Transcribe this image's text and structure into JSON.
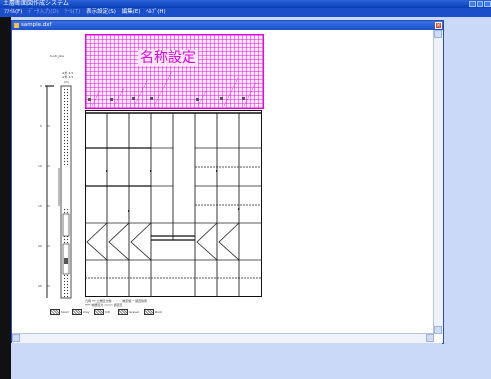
{
  "window": {
    "title": "土層断面図作成システム",
    "controls": [
      "minimize-icon",
      "maximize-icon",
      "close-icon"
    ]
  },
  "menubar": {
    "items": [
      {
        "label": "ﾌｧｲﾙ(F)",
        "enabled": true
      },
      {
        "label": "ﾃﾞｰﾀ入力(D)",
        "enabled": false
      },
      {
        "label": "ﾂｰﾙ(T)",
        "enabled": false
      },
      {
        "label": "表示設定(S)",
        "enabled": true
      },
      {
        "label": "編集(E)",
        "enabled": true
      },
      {
        "label": "ﾍﾙﾌﾟ(H)",
        "enabled": true
      }
    ]
  },
  "document": {
    "title": "sample.dxf",
    "close_glyph": "×",
    "header_title": "名称設定",
    "side_labels": [
      "tuuti_pile",
      "※外 4.5",
      "※外 4.5",
      "(m)"
    ],
    "depth_ticks": [
      "0",
      "5",
      "10",
      "15",
      "20",
      "25"
    ],
    "note_line1": "凡例  ━━ 土層区分線  ・・・ 推定線  ─ 調査箇所",
    "note_line2": "━━━ 地層区分  ▭▭▭ 調査孔",
    "legend": [
      "Sand",
      "Clay",
      "Silt",
      "Gravel",
      "Rock"
    ],
    "colors": {
      "header": "#e000e0",
      "titlebar": "#1e50c8",
      "workspace": "#c9d9f7"
    }
  }
}
